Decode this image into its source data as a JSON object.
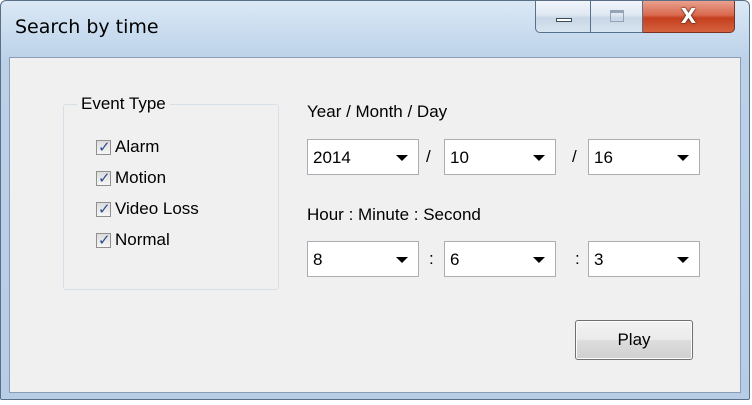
{
  "window": {
    "title": "Search by time",
    "close_glyph": "X"
  },
  "event_type": {
    "legend": "Event Type",
    "items": [
      {
        "label": "Alarm",
        "checked": true
      },
      {
        "label": "Motion",
        "checked": true
      },
      {
        "label": "Video Loss",
        "checked": true
      },
      {
        "label": "Normal",
        "checked": true
      }
    ],
    "check_glyph": "✓"
  },
  "date": {
    "label": "Year / Month / Day",
    "year": "2014",
    "month": "10",
    "day": "16",
    "separator": "/"
  },
  "time": {
    "label": "Hour : Minute : Second",
    "hour": "8",
    "minute": "6",
    "second": "3",
    "separator": ":"
  },
  "actions": {
    "play_label": "Play"
  },
  "icons": {
    "minimize": "minimize-icon",
    "maximize": "maximize-icon",
    "close": "close-icon",
    "dropdown": "chevron-down-icon",
    "checkbox": "checkmark-icon"
  },
  "colors": {
    "title_bar": "#bcd1e8",
    "close_button": "#c5401f",
    "client_background": "#f0f0f0",
    "check_mark": "#2d4e8c"
  }
}
